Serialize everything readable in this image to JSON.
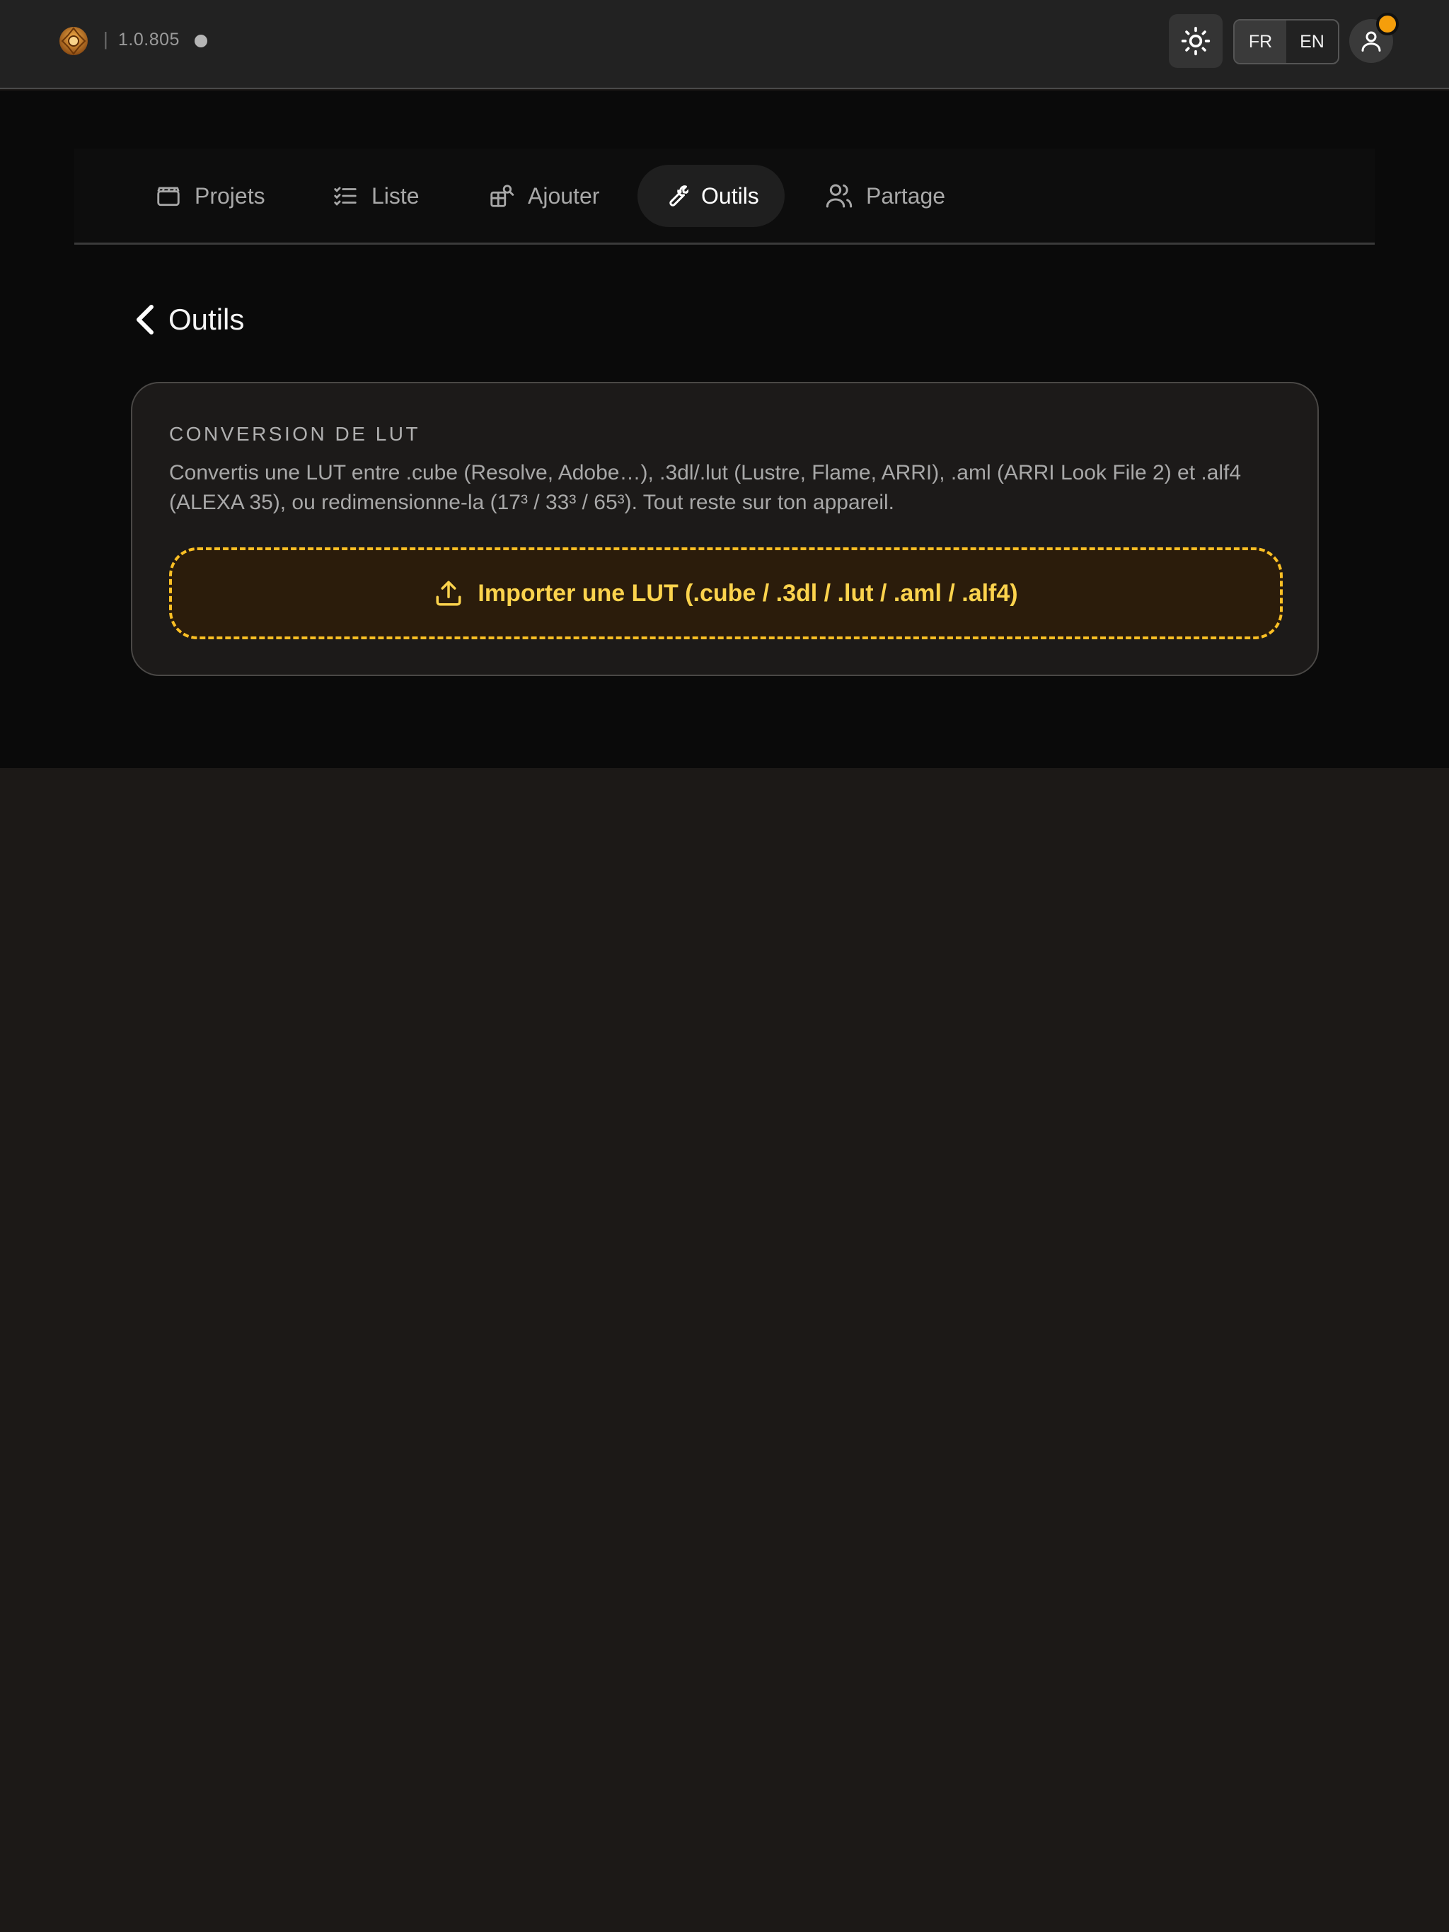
{
  "header": {
    "version": "1.0.805",
    "separator": "|",
    "languages": [
      {
        "label": "FR",
        "active": true
      },
      {
        "label": "EN",
        "active": false
      }
    ],
    "colors": {
      "accent": "#f59e0b",
      "notification": "#f59e0b"
    }
  },
  "nav": {
    "tabs": [
      {
        "label": "Projets",
        "icon": "clapperboard-icon",
        "active": false
      },
      {
        "label": "Liste",
        "icon": "checklist-icon",
        "active": false
      },
      {
        "label": "Ajouter",
        "icon": "add-search-icon",
        "active": false
      },
      {
        "label": "Outils",
        "icon": "wrench-icon",
        "active": true
      },
      {
        "label": "Partage",
        "icon": "users-icon",
        "active": false
      }
    ]
  },
  "page": {
    "title": "Outils"
  },
  "card": {
    "title": "CONVERSION DE LUT",
    "description": "Convertis une LUT entre .cube (Resolve, Adobe…), .3dl/.lut (Lustre, Flame, ARRI), .aml (ARRI Look File 2) et .alf4 (ALEXA 35), ou redimensionne-la (17³ / 33³ / 65³). Tout reste sur ton appareil.",
    "upload_label": "Importer une LUT (.cube / .3dl / .lut / .aml / .alf4)",
    "upload_icon": "upload-icon"
  }
}
